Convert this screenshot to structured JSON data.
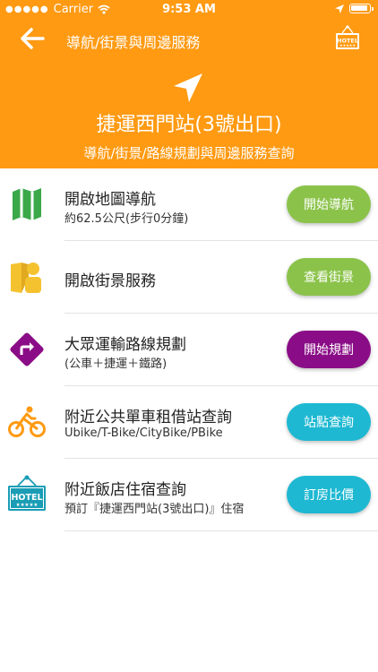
{
  "status_bar": {
    "carrier": "Carrier",
    "time": "9:53 AM"
  },
  "nav": {
    "title": "導航/街景與周邊服務"
  },
  "station": {
    "name": "捷運西門站(3號出口)",
    "subtitle": "導航/街景/路線規劃與周邊服務查詢"
  },
  "items": [
    {
      "title": "開啟地圖導航",
      "subtitle": "約62.5公尺(步行0分鐘)",
      "button": "開始導航",
      "icon": "map-icon",
      "color": "#8BC34A"
    },
    {
      "title": "開啟街景服務",
      "button": "查看街景",
      "icon": "street-view-icon",
      "color": "#8BC34A"
    },
    {
      "title": "大眾運輸路線規劃",
      "subtitle": "(公車＋捷運＋鐵路)",
      "button": "開始規劃",
      "icon": "directions-icon",
      "color": "#8A0D87"
    },
    {
      "title": "附近公共單車租借站查詢",
      "subtitle": "Ubike/T-Bike/CityBike/PBike",
      "button": "站點查詢",
      "icon": "bike-icon",
      "color": "#1EB8D2"
    },
    {
      "title": "附近飯店住宿查詢",
      "subtitle": "預訂『捷運西門站(3號出口)』住宿",
      "button": "訂房比價",
      "icon": "hotel-icon",
      "color": "#1EB8D2"
    }
  ],
  "hotel_sign": {
    "text": "HOTEL",
    "stars": "★★★★★"
  },
  "colors": {
    "header": "#FF9A12",
    "accent_green": "#8BC34A",
    "accent_purple": "#8A0D87",
    "accent_cyan": "#1EB8D2",
    "map_green": "#3BA84A",
    "street_yellow": "#F5C22F",
    "hotel_teal": "#1A9DB5"
  }
}
